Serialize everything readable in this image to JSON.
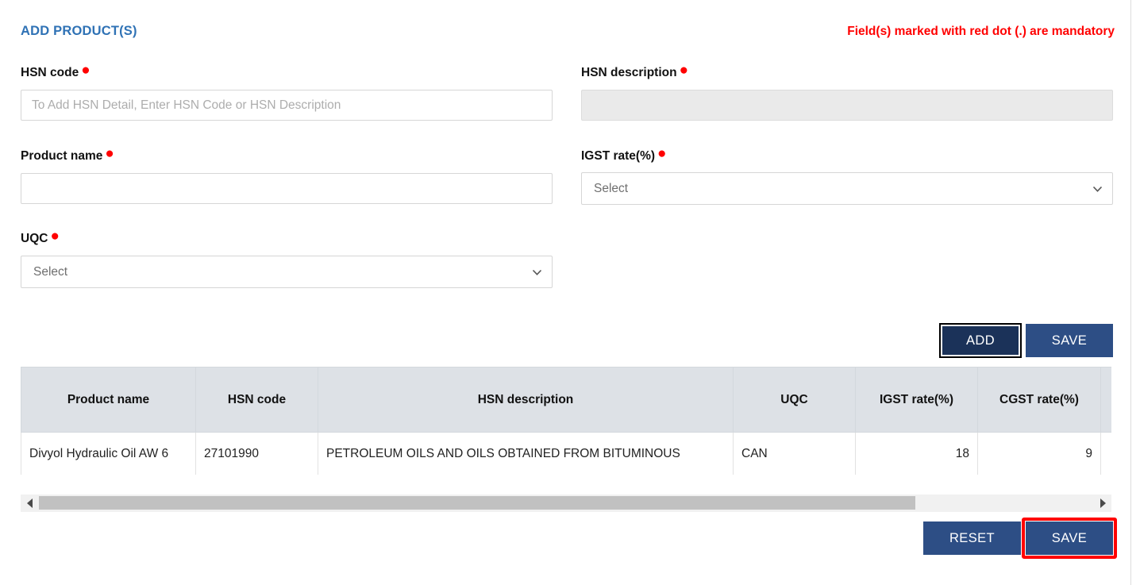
{
  "header": {
    "title": "ADD PRODUCT(S)",
    "mandatory_note": "Field(s) marked with red dot (.) are mandatory",
    "title_color": "#2f72b5",
    "note_color": "#ff0000"
  },
  "form": {
    "hsn_code": {
      "label": "HSN code",
      "placeholder": "To Add HSN Detail, Enter HSN Code or HSN Description",
      "value": ""
    },
    "hsn_description": {
      "label": "HSN description",
      "placeholder": "",
      "value": ""
    },
    "product_name": {
      "label": "Product name",
      "placeholder": "",
      "value": ""
    },
    "igst_rate": {
      "label": "IGST rate(%)",
      "selected": "Select"
    },
    "uqc": {
      "label": "UQC",
      "selected": "Select"
    }
  },
  "actions": {
    "add_label": "ADD",
    "save_label": "SAVE",
    "reset_label": "RESET",
    "bottom_save_label": "SAVE",
    "button_color": "#2d4e85",
    "add_button_color": "#1b3259",
    "highlight_color": "#ff0000"
  },
  "table": {
    "columns": [
      "Product name",
      "HSN code",
      "HSN description",
      "UQC",
      "IGST rate(%)",
      "CGST rate(%)"
    ],
    "rows": [
      {
        "product_name": "Divyol Hydraulic Oil AW 6",
        "hsn_code": "27101990",
        "hsn_description": "PETROLEUM OILS AND OILS OBTAINED FROM BITUMINOUS",
        "uqc": "CAN",
        "igst_rate": "18",
        "cgst_rate": "9"
      }
    ]
  },
  "scrollbar": {
    "left_arrow": "left-arrow",
    "right_arrow": "right-arrow"
  }
}
